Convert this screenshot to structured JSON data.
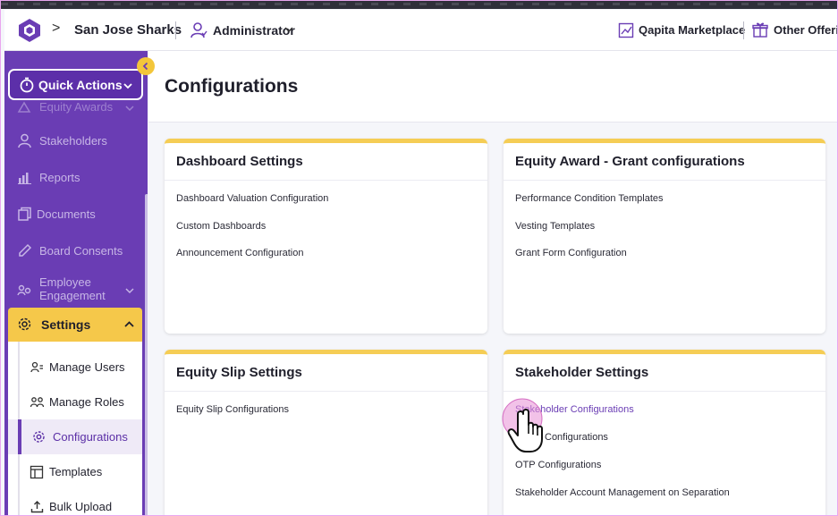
{
  "header": {
    "company": "San Jose Sharks",
    "role": "Administrator",
    "marketplace": "Qapita Marketplace",
    "other": "Other Offerin"
  },
  "sidebar": {
    "quick_actions": "Quick Actions",
    "items": [
      {
        "label": "Equity Awards",
        "icon": "award-icon"
      },
      {
        "label": "Stakeholders",
        "icon": "person-icon"
      },
      {
        "label": "Reports",
        "icon": "bar-chart-icon"
      },
      {
        "label": "Documents",
        "icon": "documents-icon"
      },
      {
        "label": "Board Consents",
        "icon": "pen-icon"
      },
      {
        "label": "Employee Engagement",
        "icon": "engagement-icon"
      }
    ],
    "settings": "Settings",
    "settings_items": [
      {
        "label": "Manage Users",
        "icon": "users-icon"
      },
      {
        "label": "Manage Roles",
        "icon": "roles-icon"
      },
      {
        "label": "Configurations",
        "icon": "gear-icon",
        "active": true
      },
      {
        "label": "Templates",
        "icon": "template-icon"
      },
      {
        "label": "Bulk Upload",
        "icon": "upload-icon"
      }
    ]
  },
  "page": {
    "title": "Configurations"
  },
  "cards": [
    {
      "title": "Dashboard Settings",
      "links": [
        "Dashboard Valuation Configuration",
        "Custom Dashboards",
        "Announcement Configuration"
      ]
    },
    {
      "title": "Equity Award - Grant configurations",
      "links": [
        "Performance Condition Templates",
        "Vesting Templates",
        "Grant Form Configuration"
      ]
    },
    {
      "title": "Equity Slip Settings",
      "links": [
        "Equity Slip Configurations"
      ]
    },
    {
      "title": "Stakeholder Settings",
      "links": [
        "Stakeholder Configurations",
        "Configurations",
        "OTP Configurations",
        "Stakeholder Account Management on Separation"
      ]
    }
  ],
  "colors": {
    "brand_purple": "#6a3db4",
    "accent_yellow": "#f5cd55",
    "cursor_highlight": "#e88fd6"
  }
}
